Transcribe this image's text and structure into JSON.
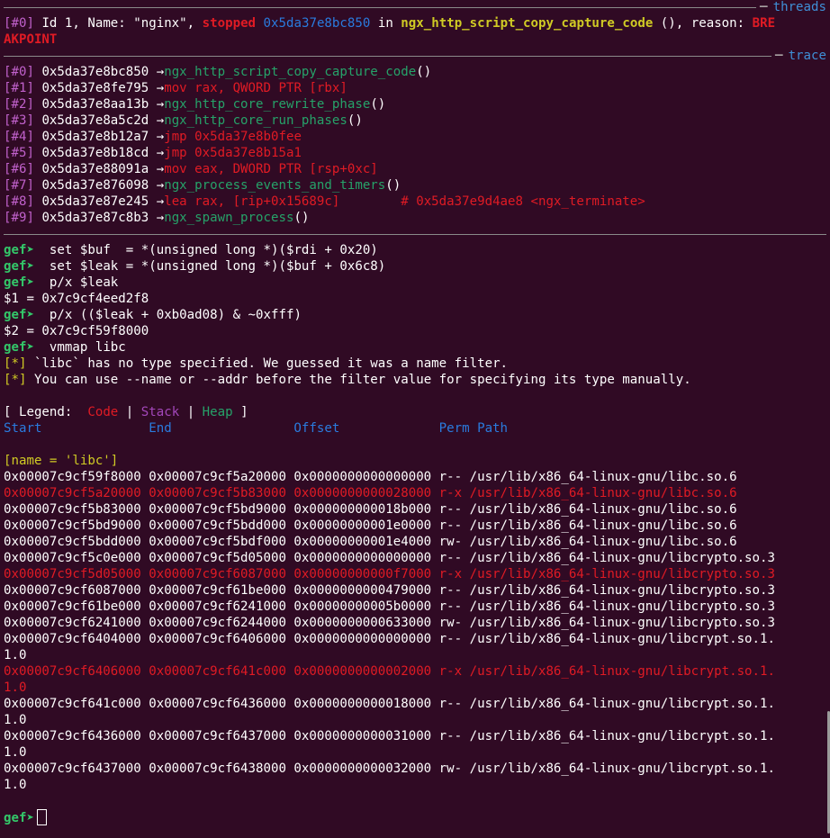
{
  "threads_header": {
    "label": "threads",
    "arrow": "─"
  },
  "thread_line": {
    "idx": "[#0]",
    "desc": " Id 1, Name: \"nginx\", ",
    "state": "stopped",
    "addr": "0x5da37e8bc850",
    "in": " in ",
    "func": "ngx_http_script_copy_capture_code",
    "tail": " (), reason: ",
    "reason_part1": "BRE",
    "reason_part2": "AKPOINT"
  },
  "trace_header": {
    "label": "trace",
    "arrow": "─"
  },
  "trace": [
    {
      "idx": "[#0]",
      "addr": " 0x5da37e8bc850 →",
      "text": "ngx_http_script_copy_capture_code",
      "suffix": "()",
      "color": "green"
    },
    {
      "idx": "[#1]",
      "addr": " 0x5da37e8fe795 →",
      "text": "mov rax, QWORD PTR [rbx]",
      "suffix": "",
      "color": "red"
    },
    {
      "idx": "[#2]",
      "addr": " 0x5da37e8aa13b →",
      "text": "ngx_http_core_rewrite_phase",
      "suffix": "()",
      "color": "green"
    },
    {
      "idx": "[#3]",
      "addr": " 0x5da37e8a5c2d →",
      "text": "ngx_http_core_run_phases",
      "suffix": "()",
      "color": "green"
    },
    {
      "idx": "[#4]",
      "addr": " 0x5da37e8b12a7 →",
      "text": "jmp 0x5da37e8b0fee",
      "suffix": "",
      "color": "red"
    },
    {
      "idx": "[#5]",
      "addr": " 0x5da37e8b18cd →",
      "text": "jmp 0x5da37e8b15a1",
      "suffix": "",
      "color": "red"
    },
    {
      "idx": "[#6]",
      "addr": " 0x5da37e88091a →",
      "text": "mov eax, DWORD PTR [rsp+0xc]",
      "suffix": "",
      "color": "red"
    },
    {
      "idx": "[#7]",
      "addr": " 0x5da37e876098 →",
      "text": "ngx_process_events_and_timers",
      "suffix": "()",
      "color": "green"
    },
    {
      "idx": "[#8]",
      "addr": " 0x5da37e87e245 →",
      "text": "lea rax, [rip+0x15689c]        # 0x5da37e9d4ae8 <ngx_terminate>",
      "suffix": "",
      "color": "red"
    },
    {
      "idx": "[#9]",
      "addr": " 0x5da37e87c8b3 →",
      "text": "ngx_spawn_process",
      "suffix": "()",
      "color": "green"
    }
  ],
  "session": [
    {
      "type": "prompt",
      "prompt": "gef➤",
      "cmd": "  set $buf  = *(unsigned long *)($rdi + 0x20)"
    },
    {
      "type": "prompt",
      "prompt": "gef➤",
      "cmd": "  set $leak = *(unsigned long *)($buf + 0x6c8)"
    },
    {
      "type": "prompt",
      "prompt": "gef➤",
      "cmd": "  p/x $leak"
    },
    {
      "type": "out",
      "text": "$1 = 0x7c9cf4eed2f8"
    },
    {
      "type": "prompt",
      "prompt": "gef➤",
      "cmd": "  p/x (($leak + 0xb0ad08) & ~0xfff)"
    },
    {
      "type": "out",
      "text": "$2 = 0x7c9cf59f8000"
    },
    {
      "type": "prompt",
      "prompt": "gef➤",
      "cmd": "  vmmap libc"
    },
    {
      "type": "warn",
      "tag": "[*]",
      "text": " `libc` has no type specified. We guessed it was a name filter."
    },
    {
      "type": "warn",
      "tag": "[*]",
      "text": " You can use --name or --addr before the filter value for specifying its type manually."
    }
  ],
  "legend": {
    "open": "[ Legend:  ",
    "code": "Code",
    "sep1": " | ",
    "stack": "Stack",
    "sep2": " | ",
    "heap": "Heap",
    "close": " ]"
  },
  "vmmap_header": "Start              End                Offset             Perm Path",
  "filter_line": "[name = 'libc']",
  "vmmap_rows": [
    {
      "text": "0x00007c9cf59f8000 0x00007c9cf5a20000 0x0000000000000000 r-- /usr/lib/x86_64-linux-gnu/libc.so.6",
      "cont": "",
      "code": false
    },
    {
      "text": "0x00007c9cf5a20000 0x00007c9cf5b83000 0x0000000000028000 r-x /usr/lib/x86_64-linux-gnu/libc.so.6",
      "cont": "",
      "code": true
    },
    {
      "text": "0x00007c9cf5b83000 0x00007c9cf5bd9000 0x000000000018b000 r-- /usr/lib/x86_64-linux-gnu/libc.so.6",
      "cont": "",
      "code": false
    },
    {
      "text": "0x00007c9cf5bd9000 0x00007c9cf5bdd000 0x00000000001e0000 r-- /usr/lib/x86_64-linux-gnu/libc.so.6",
      "cont": "",
      "code": false
    },
    {
      "text": "0x00007c9cf5bdd000 0x00007c9cf5bdf000 0x00000000001e4000 rw- /usr/lib/x86_64-linux-gnu/libc.so.6",
      "cont": "",
      "code": false
    },
    {
      "text": "0x00007c9cf5c0e000 0x00007c9cf5d05000 0x0000000000000000 r-- /usr/lib/x86_64-linux-gnu/libcrypto.so.3",
      "cont": "",
      "code": false
    },
    {
      "text": "0x00007c9cf5d05000 0x00007c9cf6087000 0x00000000000f7000 r-x /usr/lib/x86_64-linux-gnu/libcrypto.so.3",
      "cont": "",
      "code": true
    },
    {
      "text": "0x00007c9cf6087000 0x00007c9cf61be000 0x0000000000479000 r-- /usr/lib/x86_64-linux-gnu/libcrypto.so.3",
      "cont": "",
      "code": false
    },
    {
      "text": "0x00007c9cf61be000 0x00007c9cf6241000 0x00000000005b0000 r-- /usr/lib/x86_64-linux-gnu/libcrypto.so.3",
      "cont": "",
      "code": false
    },
    {
      "text": "0x00007c9cf6241000 0x00007c9cf6244000 0x0000000000633000 rw- /usr/lib/x86_64-linux-gnu/libcrypto.so.3",
      "cont": "",
      "code": false
    },
    {
      "text": "0x00007c9cf6404000 0x00007c9cf6406000 0x0000000000000000 r-- /usr/lib/x86_64-linux-gnu/libcrypt.so.1.",
      "cont": "1.0",
      "code": false
    },
    {
      "text": "0x00007c9cf6406000 0x00007c9cf641c000 0x0000000000002000 r-x /usr/lib/x86_64-linux-gnu/libcrypt.so.1.",
      "cont": "1.0",
      "code": true
    },
    {
      "text": "0x00007c9cf641c000 0x00007c9cf6436000 0x0000000000018000 r-- /usr/lib/x86_64-linux-gnu/libcrypt.so.1.",
      "cont": "1.0",
      "code": false
    },
    {
      "text": "0x00007c9cf6436000 0x00007c9cf6437000 0x0000000000031000 r-- /usr/lib/x86_64-linux-gnu/libcrypt.so.1.",
      "cont": "1.0",
      "code": false
    },
    {
      "text": "0x00007c9cf6437000 0x00007c9cf6438000 0x0000000000032000 rw- /usr/lib/x86_64-linux-gnu/libcrypt.so.1.",
      "cont": "1.0",
      "code": false
    }
  ],
  "final_prompt": "gef➤",
  "colors": {
    "background": "#300a24",
    "code": "#e01b24",
    "stack": "#a347ba",
    "heap": "#26a269",
    "prompt": "#33c96a",
    "header_blue": "#2a7bde"
  }
}
